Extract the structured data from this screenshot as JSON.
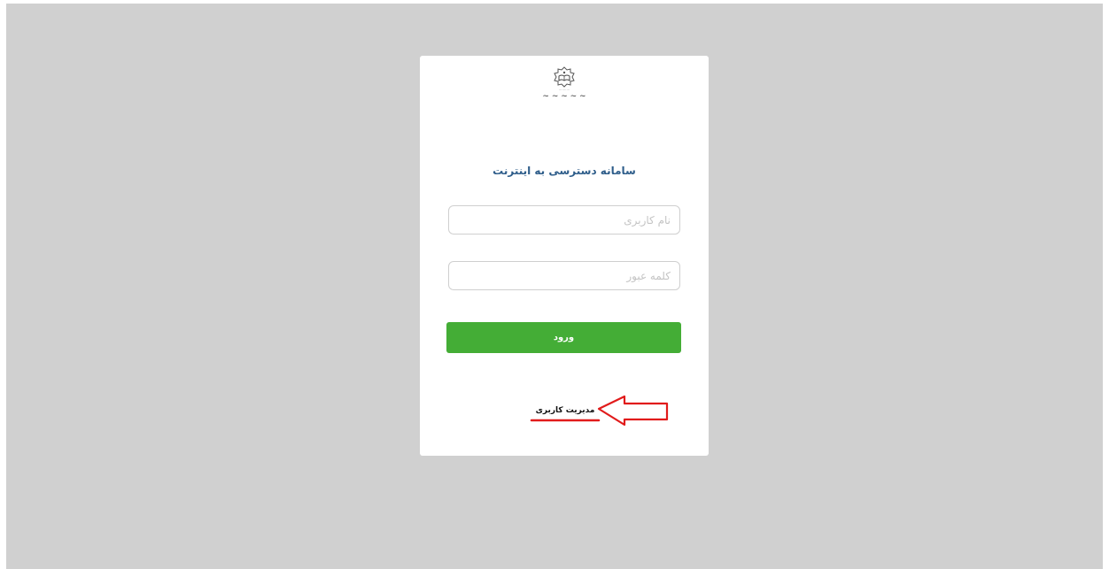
{
  "login": {
    "title": "سامانه دسترسی به اینترنت",
    "username_placeholder": "نام کاربری",
    "password_placeholder": "کلمه عبور",
    "submit_label": "ورود",
    "admin_link": "مدیریت کاربری"
  },
  "annotation": {
    "color": "#e11b1b",
    "icon": "arrow-left-outline-icon"
  },
  "colors": {
    "backdrop": "#d0d0d0",
    "title": "#2e5d8a",
    "button": "#44ad36"
  }
}
